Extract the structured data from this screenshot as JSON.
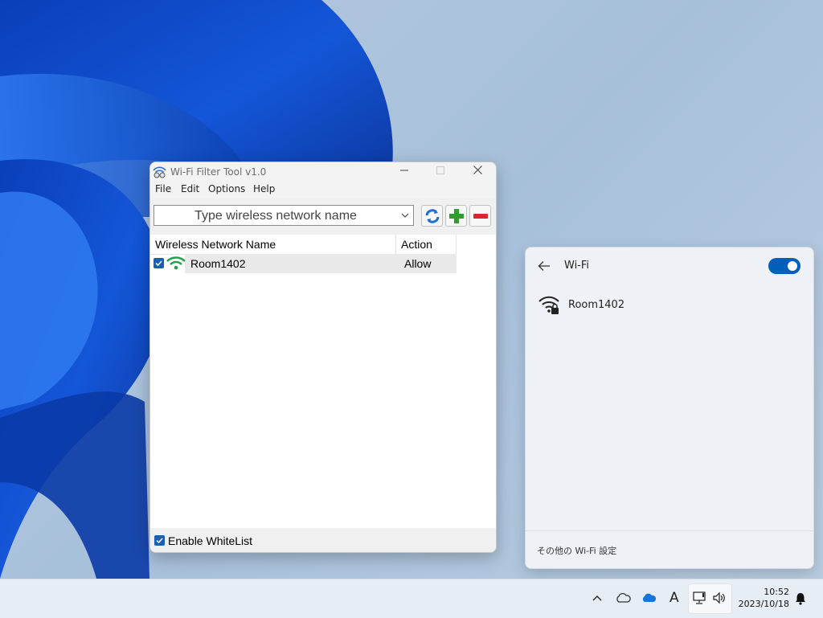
{
  "app": {
    "title": "Wi-Fi Filter Tool v1.0",
    "menu": [
      "File",
      "Edit",
      "Options",
      "Help"
    ],
    "combo_placeholder": "Type wireless network name",
    "toolbar": {
      "refresh_icon": "refresh-icon",
      "add_icon": "plus-icon",
      "remove_icon": "minus-icon"
    },
    "columns": [
      "Wireless Network Name",
      "Action"
    ],
    "rows": [
      {
        "checked": true,
        "name": "Room1402",
        "action": "Allow"
      }
    ],
    "status": {
      "enable_whitelist_label": "Enable WhiteList",
      "checked": true
    },
    "colors": {
      "accent": "#1a5fb4",
      "wifi_green": "#22a04b",
      "add_green": "#2e9e2e",
      "remove_red": "#d8262f"
    }
  },
  "flyout": {
    "title": "Wi-Fi",
    "enabled": true,
    "networks": [
      {
        "name": "Room1402",
        "secured": true
      }
    ],
    "footer_link": "その他の Wi-Fi 設定"
  },
  "taskbar": {
    "time": "10:52",
    "date": "2023/10/18",
    "ime_label": "A"
  }
}
